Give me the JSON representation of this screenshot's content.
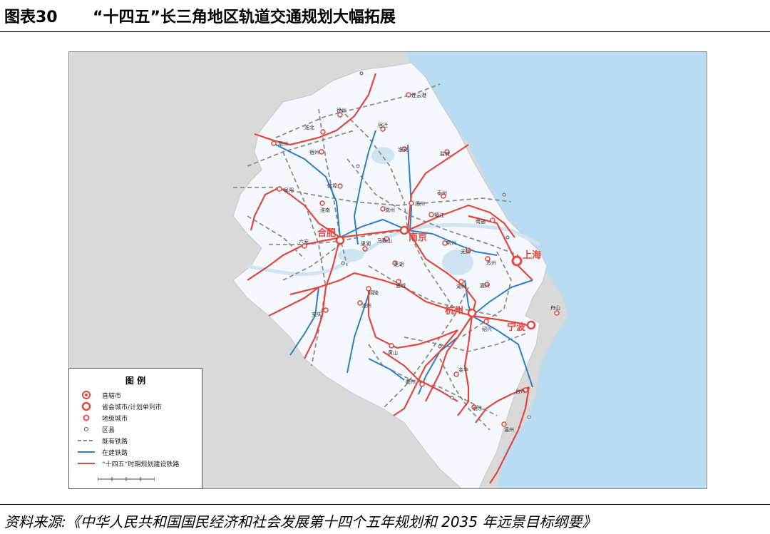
{
  "header": {
    "figure_number": "图表30",
    "title": "“十四五”长三角地区轨道交通规划大幅拓展"
  },
  "footer": {
    "source": "资料来源:《中华人民共和国国民经济和社会发展第十四个五年规划和 2035 年远景目标纲要》"
  },
  "colors": {
    "sea": "#b9dcf0",
    "land_region": "#f4f7fb",
    "land_outside": "#d9d9d9",
    "existing_rail": "#8c8c8c",
    "under_construction": "#2f7fc6",
    "planned_rail": "#e0473f",
    "city_marker": "#e0473f"
  },
  "legend": {
    "title": "图 例",
    "items": [
      {
        "symbol": "municipality-icon",
        "label": "直辖市"
      },
      {
        "symbol": "provincial-capital-icon",
        "label": "省会城市/计划单列市"
      },
      {
        "symbol": "prefecture-city-icon",
        "label": "地级城市"
      },
      {
        "symbol": "county-icon",
        "label": "区县"
      },
      {
        "symbol": "existing-rail-line",
        "label": "既有铁路"
      },
      {
        "symbol": "under-construction-rail-line",
        "label": "在建铁路"
      },
      {
        "symbol": "planned-rail-line",
        "label": "“十四五”时期规划建设铁路"
      }
    ]
  },
  "map": {
    "major_labels": [
      "上海",
      "南京",
      "合肥",
      "杭州",
      "宁波"
    ],
    "city_labels": [
      "连云港",
      "徐州",
      "宿迁",
      "淮北",
      "亳州",
      "宿州",
      "淮安",
      "盐城",
      "蚌埠",
      "阜阳",
      "淮南",
      "滁州",
      "扬州",
      "泰州",
      "镇江",
      "南通",
      "六安",
      "巢湖",
      "马鞍山",
      "常州",
      "无锡",
      "苏州",
      "芜湖",
      "宣城",
      "湖州",
      "嘉兴",
      "铜陵",
      "池州",
      "安庆",
      "黄山",
      "绍兴",
      "舟山",
      "金华",
      "衢州",
      "丽水",
      "台州",
      "温州"
    ]
  }
}
